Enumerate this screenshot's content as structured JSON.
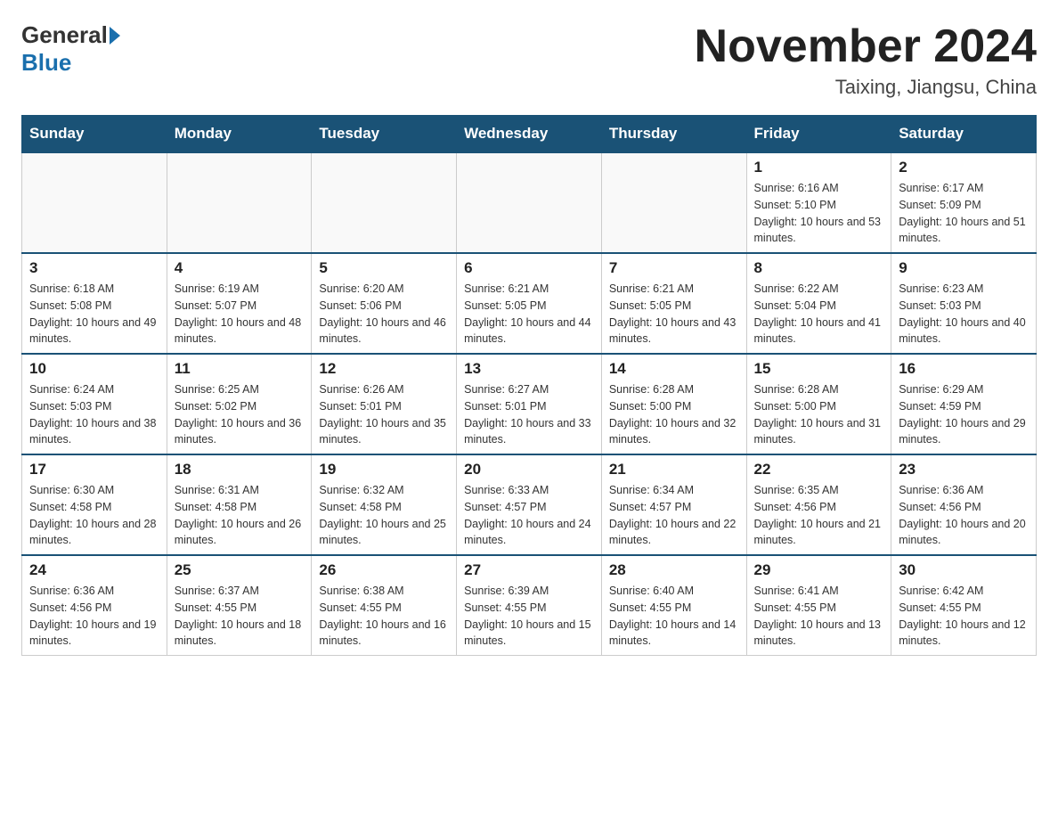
{
  "header": {
    "logo_general": "General",
    "logo_blue": "Blue",
    "month_title": "November 2024",
    "location": "Taixing, Jiangsu, China"
  },
  "days_of_week": [
    "Sunday",
    "Monday",
    "Tuesday",
    "Wednesday",
    "Thursday",
    "Friday",
    "Saturday"
  ],
  "weeks": [
    [
      {
        "day": "",
        "info": ""
      },
      {
        "day": "",
        "info": ""
      },
      {
        "day": "",
        "info": ""
      },
      {
        "day": "",
        "info": ""
      },
      {
        "day": "",
        "info": ""
      },
      {
        "day": "1",
        "info": "Sunrise: 6:16 AM\nSunset: 5:10 PM\nDaylight: 10 hours and 53 minutes."
      },
      {
        "day": "2",
        "info": "Sunrise: 6:17 AM\nSunset: 5:09 PM\nDaylight: 10 hours and 51 minutes."
      }
    ],
    [
      {
        "day": "3",
        "info": "Sunrise: 6:18 AM\nSunset: 5:08 PM\nDaylight: 10 hours and 49 minutes."
      },
      {
        "day": "4",
        "info": "Sunrise: 6:19 AM\nSunset: 5:07 PM\nDaylight: 10 hours and 48 minutes."
      },
      {
        "day": "5",
        "info": "Sunrise: 6:20 AM\nSunset: 5:06 PM\nDaylight: 10 hours and 46 minutes."
      },
      {
        "day": "6",
        "info": "Sunrise: 6:21 AM\nSunset: 5:05 PM\nDaylight: 10 hours and 44 minutes."
      },
      {
        "day": "7",
        "info": "Sunrise: 6:21 AM\nSunset: 5:05 PM\nDaylight: 10 hours and 43 minutes."
      },
      {
        "day": "8",
        "info": "Sunrise: 6:22 AM\nSunset: 5:04 PM\nDaylight: 10 hours and 41 minutes."
      },
      {
        "day": "9",
        "info": "Sunrise: 6:23 AM\nSunset: 5:03 PM\nDaylight: 10 hours and 40 minutes."
      }
    ],
    [
      {
        "day": "10",
        "info": "Sunrise: 6:24 AM\nSunset: 5:03 PM\nDaylight: 10 hours and 38 minutes."
      },
      {
        "day": "11",
        "info": "Sunrise: 6:25 AM\nSunset: 5:02 PM\nDaylight: 10 hours and 36 minutes."
      },
      {
        "day": "12",
        "info": "Sunrise: 6:26 AM\nSunset: 5:01 PM\nDaylight: 10 hours and 35 minutes."
      },
      {
        "day": "13",
        "info": "Sunrise: 6:27 AM\nSunset: 5:01 PM\nDaylight: 10 hours and 33 minutes."
      },
      {
        "day": "14",
        "info": "Sunrise: 6:28 AM\nSunset: 5:00 PM\nDaylight: 10 hours and 32 minutes."
      },
      {
        "day": "15",
        "info": "Sunrise: 6:28 AM\nSunset: 5:00 PM\nDaylight: 10 hours and 31 minutes."
      },
      {
        "day": "16",
        "info": "Sunrise: 6:29 AM\nSunset: 4:59 PM\nDaylight: 10 hours and 29 minutes."
      }
    ],
    [
      {
        "day": "17",
        "info": "Sunrise: 6:30 AM\nSunset: 4:58 PM\nDaylight: 10 hours and 28 minutes."
      },
      {
        "day": "18",
        "info": "Sunrise: 6:31 AM\nSunset: 4:58 PM\nDaylight: 10 hours and 26 minutes."
      },
      {
        "day": "19",
        "info": "Sunrise: 6:32 AM\nSunset: 4:58 PM\nDaylight: 10 hours and 25 minutes."
      },
      {
        "day": "20",
        "info": "Sunrise: 6:33 AM\nSunset: 4:57 PM\nDaylight: 10 hours and 24 minutes."
      },
      {
        "day": "21",
        "info": "Sunrise: 6:34 AM\nSunset: 4:57 PM\nDaylight: 10 hours and 22 minutes."
      },
      {
        "day": "22",
        "info": "Sunrise: 6:35 AM\nSunset: 4:56 PM\nDaylight: 10 hours and 21 minutes."
      },
      {
        "day": "23",
        "info": "Sunrise: 6:36 AM\nSunset: 4:56 PM\nDaylight: 10 hours and 20 minutes."
      }
    ],
    [
      {
        "day": "24",
        "info": "Sunrise: 6:36 AM\nSunset: 4:56 PM\nDaylight: 10 hours and 19 minutes."
      },
      {
        "day": "25",
        "info": "Sunrise: 6:37 AM\nSunset: 4:55 PM\nDaylight: 10 hours and 18 minutes."
      },
      {
        "day": "26",
        "info": "Sunrise: 6:38 AM\nSunset: 4:55 PM\nDaylight: 10 hours and 16 minutes."
      },
      {
        "day": "27",
        "info": "Sunrise: 6:39 AM\nSunset: 4:55 PM\nDaylight: 10 hours and 15 minutes."
      },
      {
        "day": "28",
        "info": "Sunrise: 6:40 AM\nSunset: 4:55 PM\nDaylight: 10 hours and 14 minutes."
      },
      {
        "day": "29",
        "info": "Sunrise: 6:41 AM\nSunset: 4:55 PM\nDaylight: 10 hours and 13 minutes."
      },
      {
        "day": "30",
        "info": "Sunrise: 6:42 AM\nSunset: 4:55 PM\nDaylight: 10 hours and 12 minutes."
      }
    ]
  ]
}
